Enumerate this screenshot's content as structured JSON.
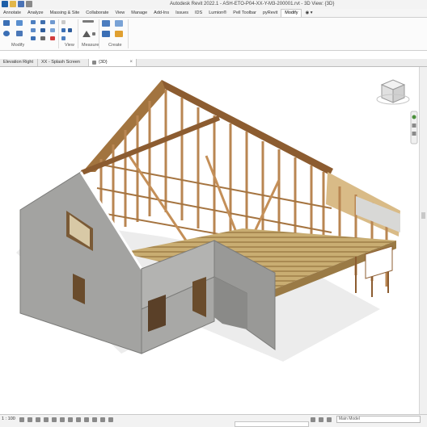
{
  "window": {
    "title": "Autodesk Revit 2022.1 - ASH-ETO-P04-XX-Y-M3-200001.rvt - 3D View: {3D}"
  },
  "ribbon": {
    "tabs": [
      "Annotate",
      "Analyze",
      "Massing & Site",
      "Collaborate",
      "View",
      "Manage",
      "Add-Ins",
      "Issues",
      "IDS",
      "Lumion®",
      "Pell Toolbar",
      "pyRevit",
      "Modify"
    ],
    "active_tab": "Modify",
    "groups": [
      "Modify",
      "View",
      "Measure",
      "Create"
    ]
  },
  "view_tabs": [
    {
      "label": "Elevation Right",
      "active": false
    },
    {
      "label": "XX - Splash Screen",
      "active": false
    },
    {
      "label": "{3D}",
      "active": true
    }
  ],
  "status": {
    "scale": "1 : 100",
    "model_selector": "Main Model"
  },
  "colors": {
    "timber": "#b98652",
    "timber_dark": "#8c5c30",
    "panel": "#9a9a98",
    "floor": "#c7a86c"
  }
}
